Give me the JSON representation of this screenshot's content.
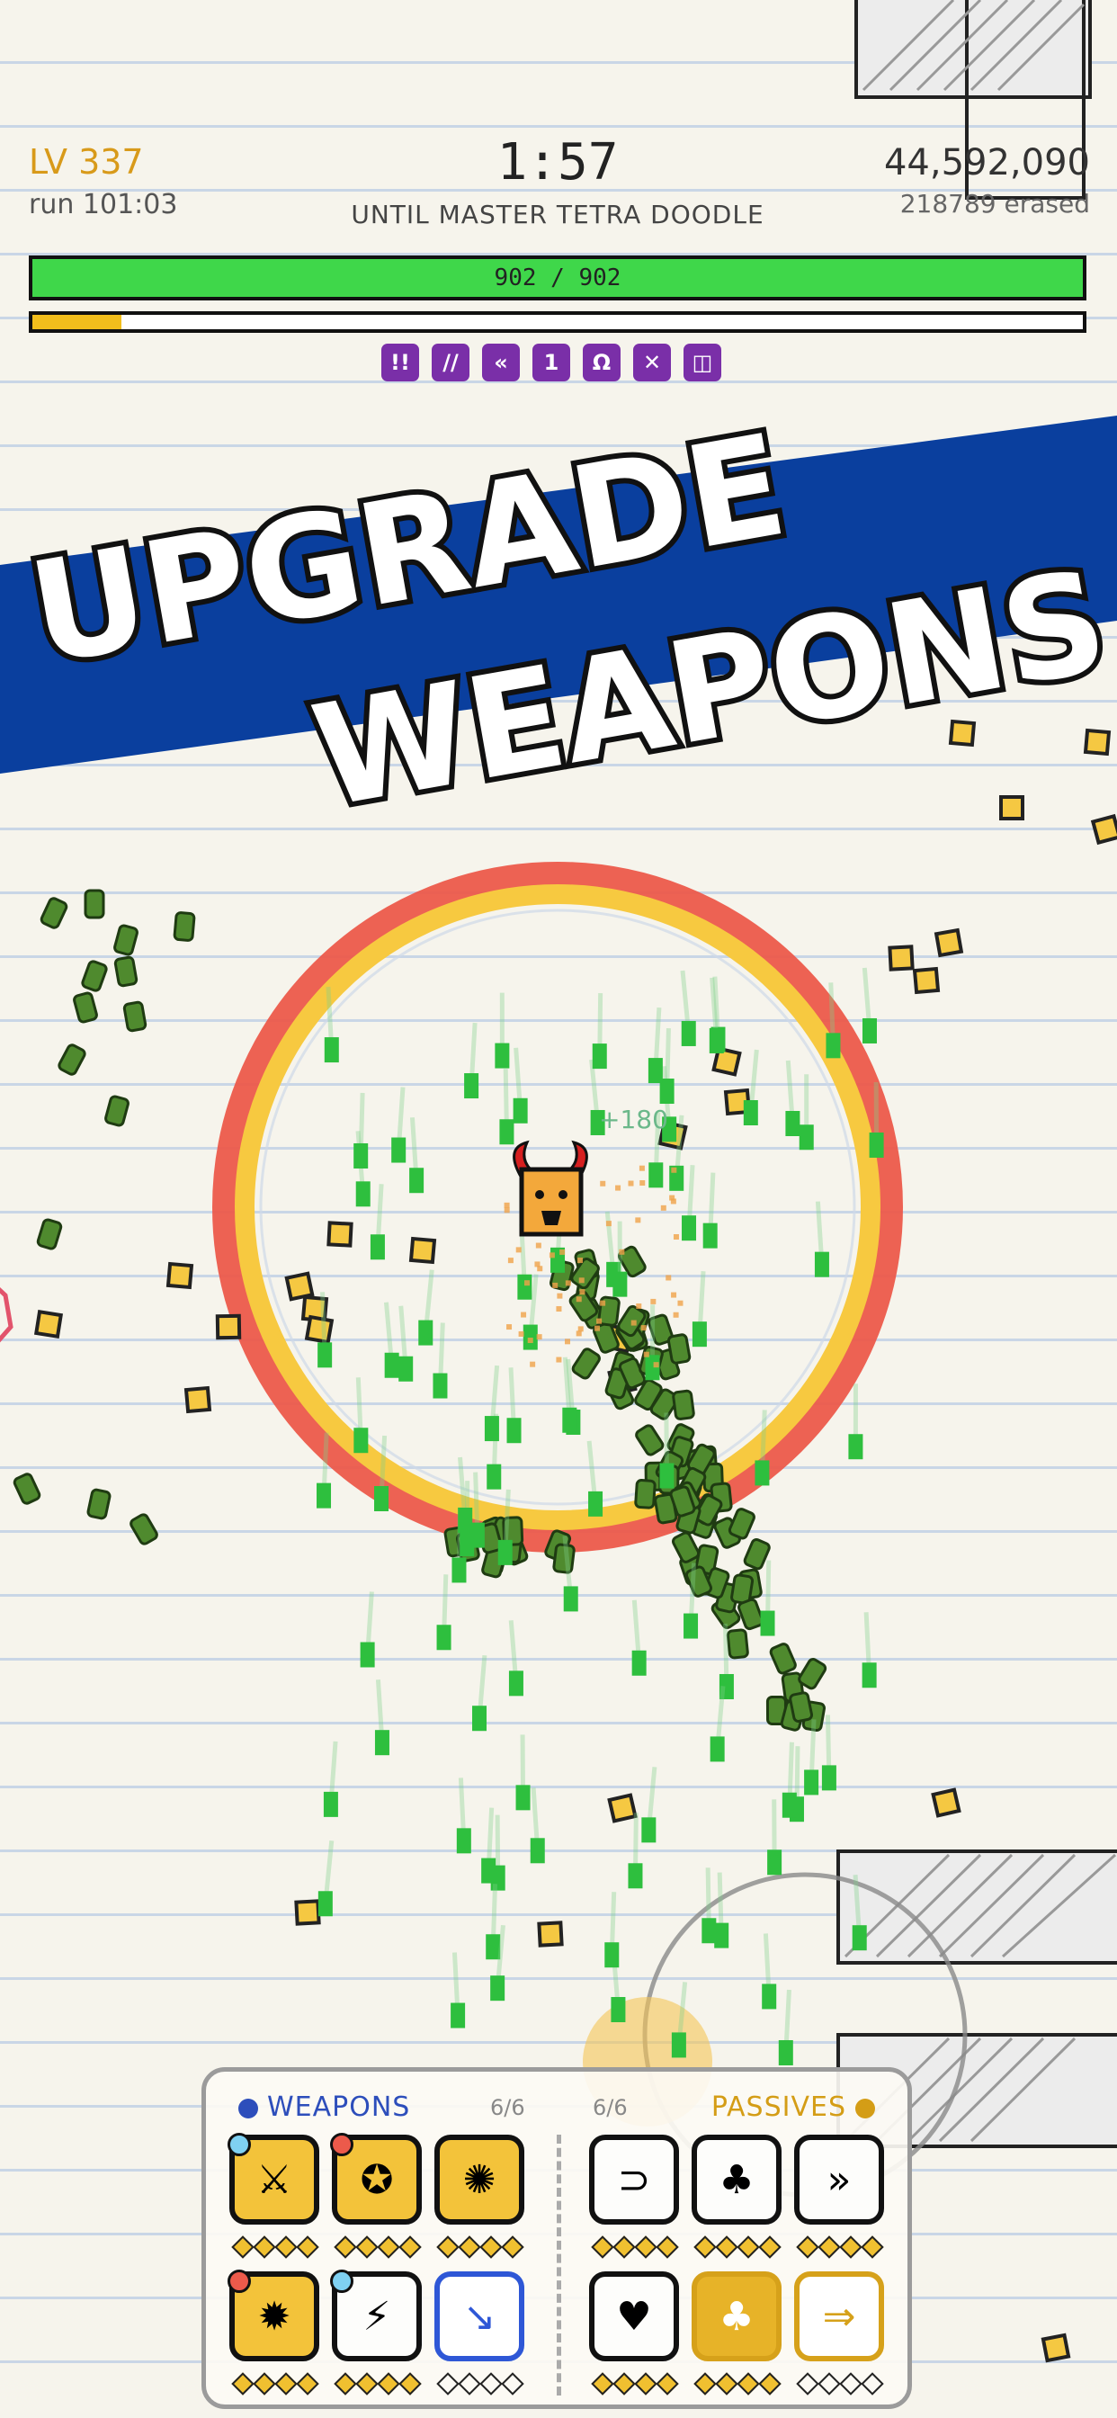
{
  "hud": {
    "level": "LV 337",
    "run_time": "run 101:03",
    "timer": "1:57",
    "until_text": "UNTIL MASTER TETRA DOODLE",
    "score": "44,592,090",
    "erased": "218789 erased",
    "hp_text": "902 / 902",
    "hp_fraction": 1.0,
    "xp_fraction": 0.085,
    "buffs": [
      "!!",
      "//",
      "«",
      "1",
      "Ω",
      "✕",
      "◫"
    ]
  },
  "banner": {
    "line1": "UPGRADE",
    "line2": "WEAPONS",
    "stripe_color": "#0a3f9e"
  },
  "world": {
    "damage_popup": "+180"
  },
  "panel": {
    "weapons_title": "WEAPONS",
    "weapons_count": "6/6",
    "passives_title": "PASSIVES",
    "passives_count": "6/6"
  },
  "colors": {
    "hp": "#3fd74a",
    "xp": "#f2be1c",
    "buff": "#7a2fa8",
    "weapons_accent": "#2d4ebb",
    "passives_accent": "#d49d16",
    "ring_outer": "#ec5a4b",
    "ring_inner": "#f7c940"
  }
}
